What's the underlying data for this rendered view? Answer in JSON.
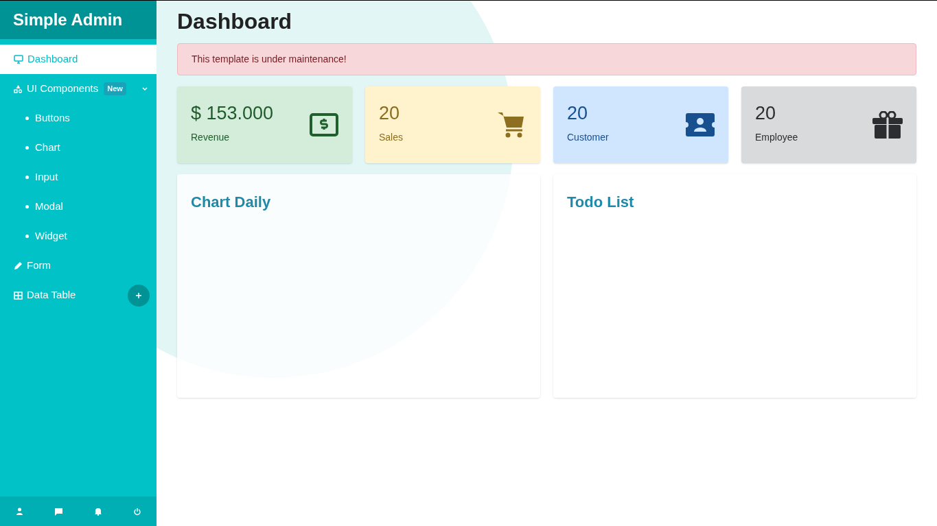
{
  "sidebar": {
    "title": "Simple Admin",
    "items": [
      {
        "kind": "link",
        "label": "Dashboard",
        "selected": true
      },
      {
        "kind": "group",
        "label": "UI Components",
        "badge": "New",
        "selected": false,
        "expanded": true,
        "children": [
          {
            "label": "Buttons",
            "selected": false
          },
          {
            "label": "Chart",
            "selected": false
          },
          {
            "label": "Input",
            "selected": false
          },
          {
            "label": "Modal",
            "selected": false
          },
          {
            "label": "Widget",
            "selected": false
          }
        ]
      },
      {
        "kind": "link",
        "label": "Form",
        "selected": false
      },
      {
        "kind": "add",
        "label": "Data Table",
        "selected": false
      }
    ]
  },
  "page_title": "Dashboard",
  "alert": "This template is under maintenance!",
  "stats": [
    {
      "kind": "revenue",
      "value": "$ 153.000",
      "label": "Revenue"
    },
    {
      "kind": "sales",
      "value": "20",
      "label": "Sales"
    },
    {
      "kind": "customer",
      "value": "20",
      "label": "Customer"
    },
    {
      "kind": "employee",
      "value": "20",
      "label": "Employee"
    }
  ],
  "panels": [
    {
      "title": "Chart Daily"
    },
    {
      "title": "Todo List"
    }
  ]
}
